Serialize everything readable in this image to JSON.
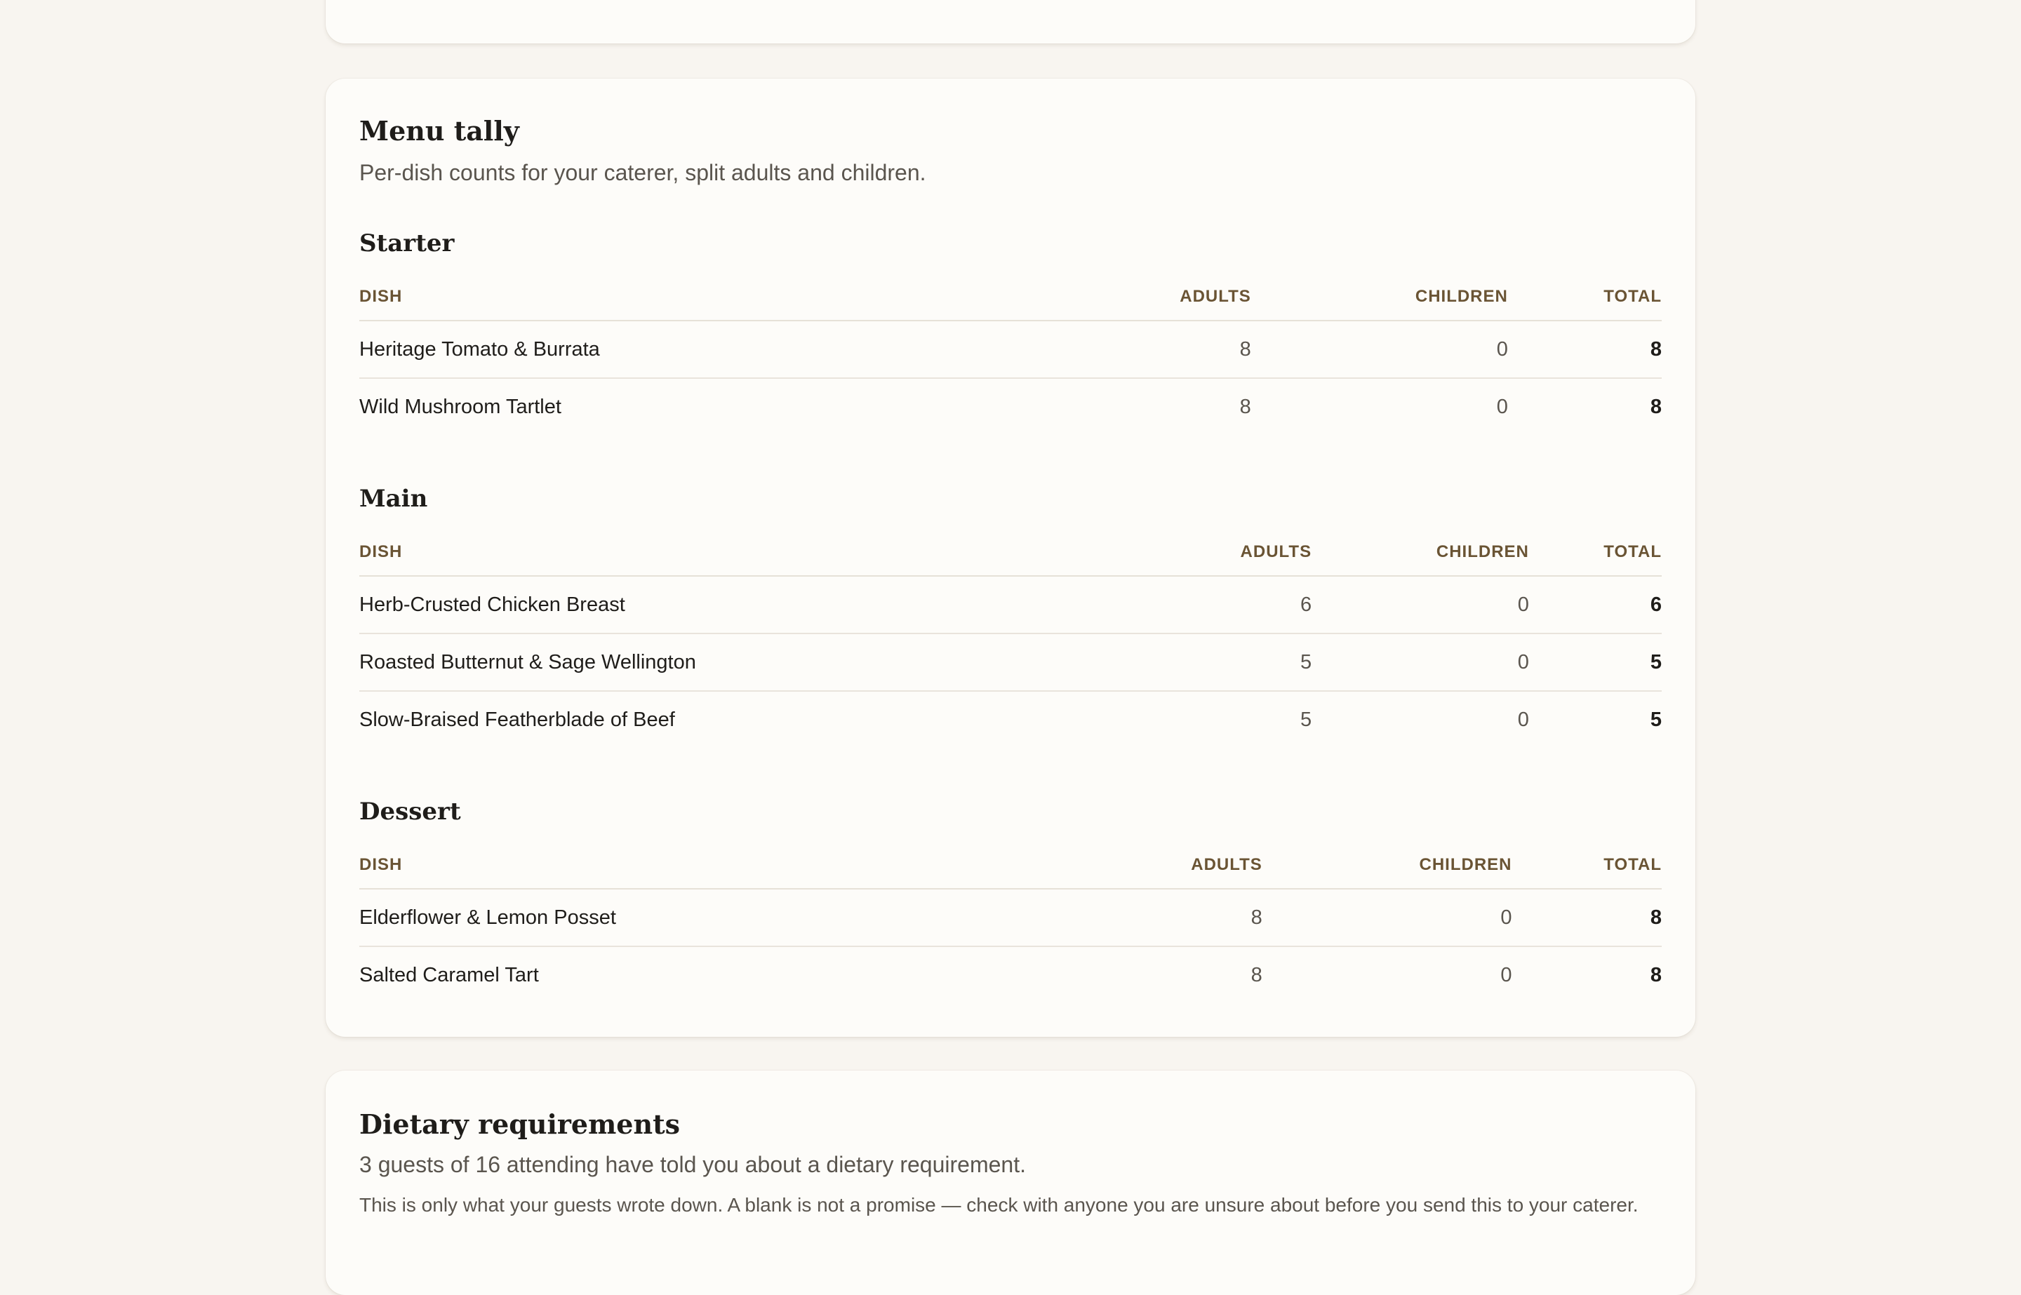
{
  "menu_tally": {
    "title": "Menu tally",
    "subtitle": "Per-dish counts for your caterer, split adults and children.",
    "columns": {
      "dish": "DISH",
      "adults": "ADULTS",
      "children": "CHILDREN",
      "total": "TOTAL"
    },
    "sections": [
      {
        "name": "Starter",
        "rows": [
          {
            "dish": "Heritage Tomato & Burrata",
            "adults": "8",
            "children": "0",
            "total": "8"
          },
          {
            "dish": "Wild Mushroom Tartlet",
            "adults": "8",
            "children": "0",
            "total": "8"
          }
        ]
      },
      {
        "name": "Main",
        "rows": [
          {
            "dish": "Herb-Crusted Chicken Breast",
            "adults": "6",
            "children": "0",
            "total": "6"
          },
          {
            "dish": "Roasted Butternut & Sage Wellington",
            "adults": "5",
            "children": "0",
            "total": "5"
          },
          {
            "dish": "Slow-Braised Featherblade of Beef",
            "adults": "5",
            "children": "0",
            "total": "5"
          }
        ]
      },
      {
        "name": "Dessert",
        "rows": [
          {
            "dish": "Elderflower & Lemon Posset",
            "adults": "8",
            "children": "0",
            "total": "8"
          },
          {
            "dish": "Salted Caramel Tart",
            "adults": "8",
            "children": "0",
            "total": "8"
          }
        ]
      }
    ]
  },
  "dietary": {
    "title": "Dietary requirements",
    "summary": "3 guests of 16 attending have told you about a dietary requirement.",
    "note": "This is only what your guests wrote down. A blank is not a promise — check with anyone you are unsure about before you send this to your caterer."
  }
}
